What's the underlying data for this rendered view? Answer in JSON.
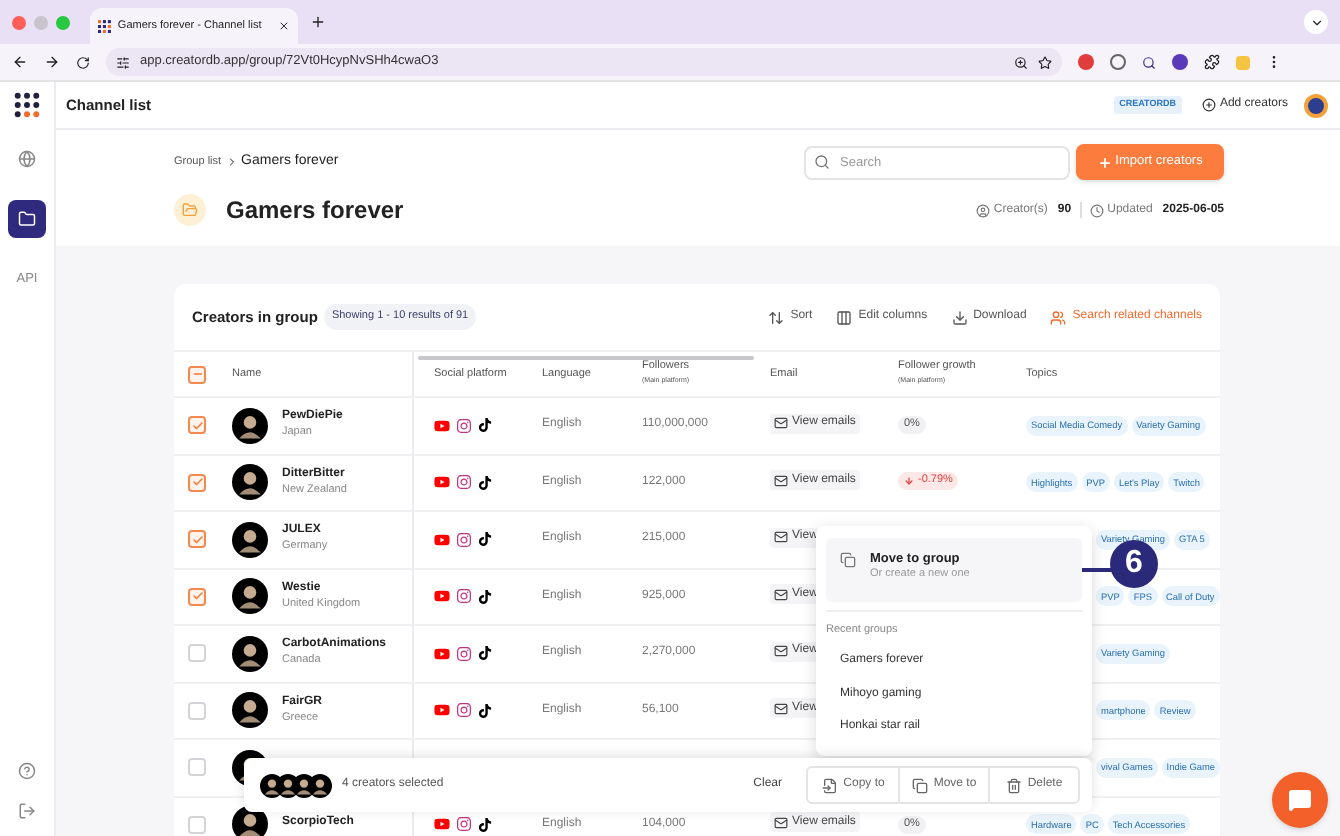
{
  "browser": {
    "tab_title": "Gamers forever - Channel list",
    "url": "app.creatordb.app/group/72Vt0HcypNvSHh4cwaO3"
  },
  "sidebar": {
    "items": [
      {
        "kind": "globe",
        "selected": false
      },
      {
        "kind": "folder",
        "selected": true
      },
      {
        "kind": "label",
        "label": "API",
        "selected": false
      }
    ]
  },
  "header": {
    "title": "Channel list",
    "badge": "CREATORDB",
    "add_button": "Add creators"
  },
  "breadcrumb": [
    {
      "label": "Group list"
    },
    {
      "label": "Gamers forever"
    }
  ],
  "search": {
    "placeholder": "Search"
  },
  "import_button": "Import creators",
  "group": {
    "title": "Gamers forever",
    "creators_label": "Creator(s)",
    "creators_count": "90",
    "updated_label": "Updated",
    "updated_date": "2025-06-05"
  },
  "card": {
    "title": "Creators in group",
    "showing": "Showing 1 - 10 results of 91",
    "actions": [
      {
        "label": "Sort",
        "kind": "sort"
      },
      {
        "label": "Edit columns",
        "kind": "columns"
      },
      {
        "label": "Download",
        "kind": "download"
      },
      {
        "label": "Search related channels",
        "kind": "related"
      }
    ]
  },
  "table": {
    "select_all_mixed": true,
    "columns": [
      {
        "label": "Name"
      },
      {
        "label": "Social platform"
      },
      {
        "label": "Language"
      },
      {
        "label": "Followers",
        "sublabel": "(Main platform)"
      },
      {
        "label": "Email"
      },
      {
        "label": "Follower growth",
        "sublabel": "(Main platform)"
      },
      {
        "label": "Topics"
      }
    ],
    "rows": [
      {
        "checked": true,
        "name": "PewDiePie",
        "country": "Japan",
        "language": "English",
        "followers": "110,000,000",
        "email": "View emails",
        "growth": {
          "text": "0%",
          "falling": false
        },
        "topics": [
          "Social Media Comedy",
          "Variety Gaming"
        ]
      },
      {
        "checked": true,
        "name": "DitterBitter",
        "country": "New Zealand",
        "language": "English",
        "followers": "122,000",
        "email": "View emails",
        "growth": {
          "text": "-0.79%",
          "falling": true
        },
        "topics": [
          "Highlights",
          "PVP",
          "Let's Play",
          "Twitch"
        ]
      },
      {
        "checked": true,
        "name": "JULEX",
        "country": "Germany",
        "language": "English",
        "followers": "215,000",
        "email": "View",
        "topics": [
          "Variety Gaming",
          "GTA 5"
        ]
      },
      {
        "checked": true,
        "name": "Westie",
        "country": "United Kingdom",
        "language": "English",
        "followers": "925,000",
        "email": "View",
        "topics": [
          "PVP",
          "FPS",
          "Call of Duty"
        ]
      },
      {
        "checked": false,
        "name": "CarbotAnimations",
        "country": "Canada",
        "language": "English",
        "followers": "2,270,000",
        "email": "View",
        "topics": [
          "Variety Gaming"
        ]
      },
      {
        "checked": false,
        "name": "FairGR",
        "country": "Greece",
        "language": "English",
        "followers": "56,100",
        "email": "View",
        "topics": [
          "martphone",
          "Review"
        ]
      },
      {
        "checked": false,
        "topics": [
          "vival Games",
          "Indie Game"
        ]
      },
      {
        "checked": false,
        "name": "ScorpioTech",
        "language": "English",
        "followers": "104,000",
        "email": "View emails",
        "growth": {
          "text": "0%",
          "falling": false
        },
        "topics": [
          "Hardware",
          "PC",
          "Tech Accessories"
        ]
      }
    ]
  },
  "selection_bar": {
    "count_text": "4 creators selected",
    "clear": "Clear",
    "actions": [
      {
        "label": "Copy to",
        "kind": "copy"
      },
      {
        "label": "Move to",
        "kind": "move"
      },
      {
        "label": "Delete",
        "kind": "delete"
      }
    ]
  },
  "popup": {
    "title": "Move to group",
    "subtitle": "Or create a new one",
    "section": "Recent groups",
    "groups": [
      {
        "label": "Gamers forever"
      },
      {
        "label": "Mihoyo gaming"
      },
      {
        "label": "Honkai star rail"
      }
    ]
  },
  "annotation": {
    "label": "6"
  }
}
